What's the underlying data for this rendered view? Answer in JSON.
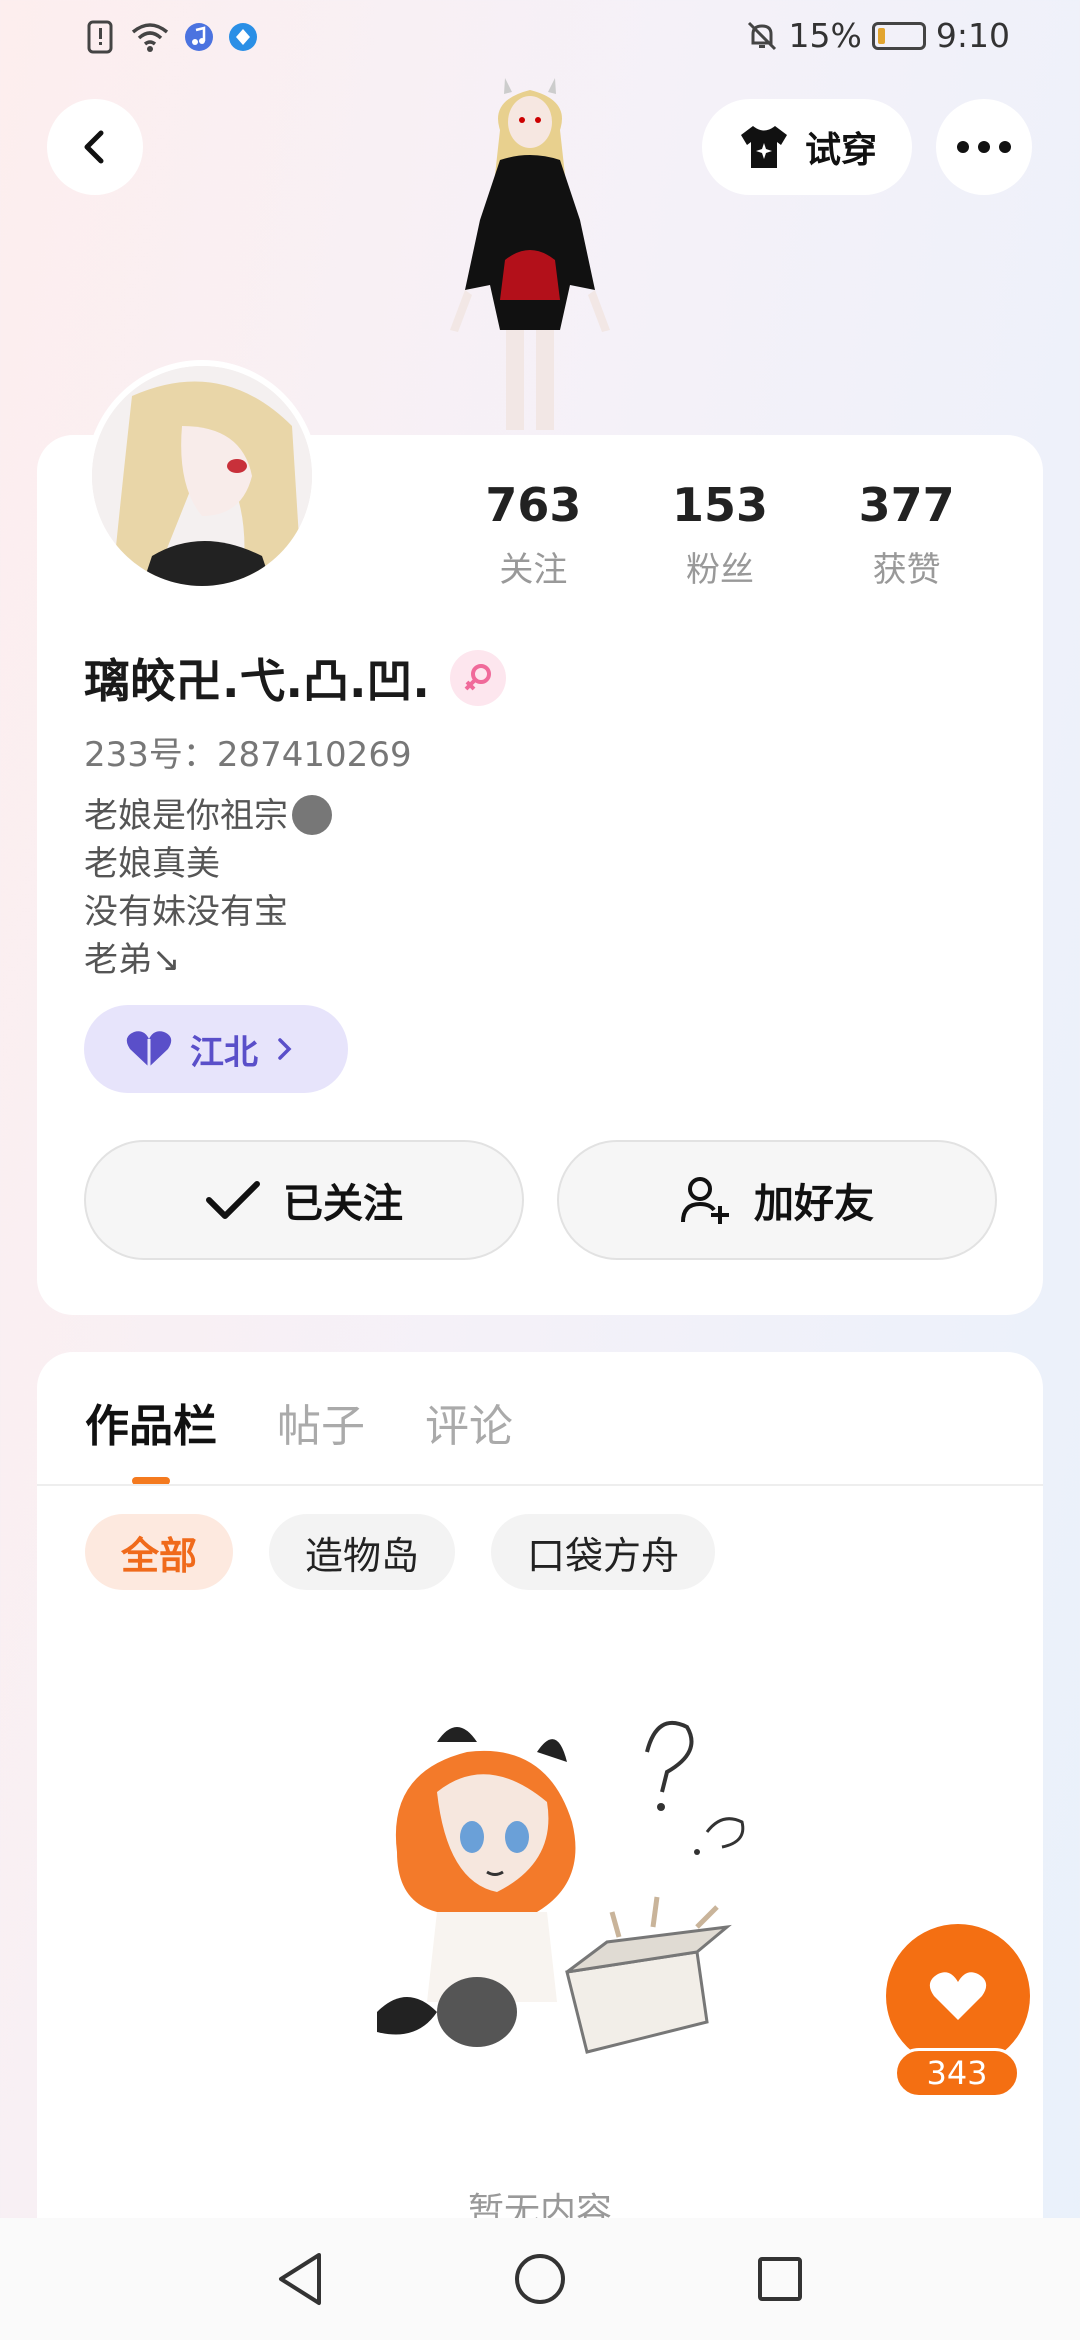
{
  "status_bar": {
    "battery_percent": "15%",
    "battery_level": 0.15,
    "time": "9:10"
  },
  "header": {
    "tryon_label": "试穿"
  },
  "profile": {
    "stats": [
      {
        "value": "763",
        "label": "关注"
      },
      {
        "value": "153",
        "label": "粉丝"
      },
      {
        "value": "377",
        "label": "获赞"
      }
    ],
    "username": "璃皎卍.弋.凸.凹.",
    "uid": "233号：287410269",
    "bio_lines": [
      "老娘是你祖宗",
      "老娘真美",
      "没有妹没有宝",
      "老弟↘"
    ],
    "guild_label": "江北",
    "follow_label": "已关注",
    "add_friend_label": "加好友"
  },
  "works": {
    "tabs": [
      "作品栏",
      "帖子",
      "评论"
    ],
    "filters": [
      "全部",
      "造物岛",
      "口袋方舟"
    ],
    "empty_text": "暂无内容"
  },
  "like_fab": {
    "count": "343"
  },
  "colors": {
    "accent": "#f46f12",
    "guild": "#5a4fc9"
  }
}
